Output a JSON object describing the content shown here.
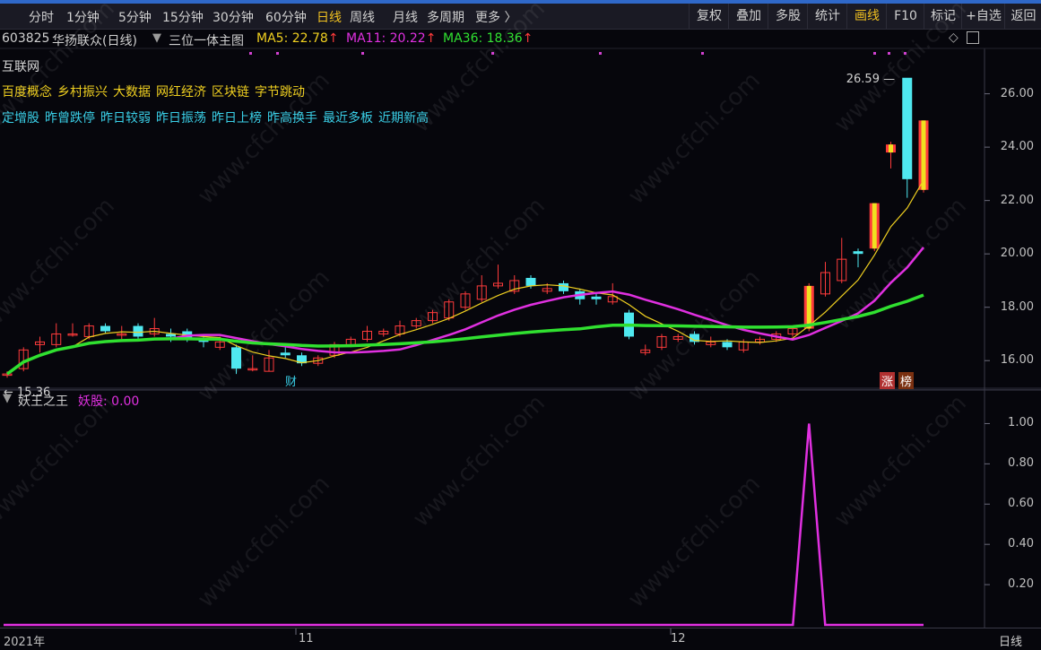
{
  "periods": [
    "分时",
    "1分钟",
    "5分钟",
    "15分钟",
    "30分钟",
    "60分钟",
    "日线",
    "周线",
    "月线",
    "多周期",
    "更多 〉"
  ],
  "active_period": "日线",
  "right_buttons": [
    "复权",
    "叠加",
    "多股",
    "统计",
    "画线",
    "F10",
    "标记",
    "+自选",
    "返回"
  ],
  "active_right": "画线",
  "stock": {
    "code": "603825",
    "name": "华扬联众(日线)",
    "indicator": "三位一体主图"
  },
  "ma": [
    {
      "label": "MA5: 22.78",
      "color": "#f0d020"
    },
    {
      "label": "MA11: 20.22",
      "color": "#e030e0"
    },
    {
      "label": "MA36: 18.36",
      "color": "#30e030"
    }
  ],
  "ma_arrow": "↑",
  "sector": "互联网",
  "concepts": [
    "百度概念",
    "乡村振兴",
    "大数据",
    "网红经济",
    "区块链",
    "字节跳动"
  ],
  "tags": [
    "定增股",
    "昨曾跌停",
    "昨日较弱",
    "昨日振荡",
    "昨日上榜",
    "昨高换手",
    "最近多板",
    "近期新高"
  ],
  "badges": {
    "cai": "财",
    "zhang": "涨",
    "bang": "榜"
  },
  "watermark": "www.cfchi.com",
  "sub": {
    "title": "妖王之王",
    "indicator": "妖股: 0.00"
  },
  "date_labels": [
    {
      "text": "2021年"
    },
    {
      "text": "11"
    },
    {
      "text": "12"
    }
  ],
  "bottom_right": "日线",
  "colors": {
    "up": "#ff3b3b",
    "down": "#4fe8f0",
    "ma5": "#f0d020",
    "ma11": "#e030e0",
    "ma36": "#30e030",
    "yao": "#e030e0",
    "limit_up": "#f0e020"
  },
  "chart_data": {
    "type": "candlestick",
    "price_axis": {
      "ticks": [
        16,
        18,
        20,
        22,
        24,
        26
      ],
      "labels": [
        "16.00",
        "18.00",
        "20.00",
        "22.00",
        "24.00",
        "26.00"
      ],
      "range": [
        15.0,
        27.7
      ]
    },
    "annotations": {
      "high": "26.59",
      "low": "15.36"
    },
    "candles": [
      {
        "o": 15.5,
        "c": 15.5,
        "h": 15.6,
        "l": 15.36
      },
      {
        "o": 15.7,
        "c": 16.4,
        "h": 16.5,
        "l": 15.6
      },
      {
        "o": 16.6,
        "c": 16.7,
        "h": 16.9,
        "l": 16.3
      },
      {
        "o": 16.6,
        "c": 17.0,
        "h": 17.4,
        "l": 16.5
      },
      {
        "o": 17.0,
        "c": 17.0,
        "h": 17.4,
        "l": 16.9
      },
      {
        "o": 16.9,
        "c": 17.3,
        "h": 17.4,
        "l": 16.8
      },
      {
        "o": 17.3,
        "c": 17.1,
        "h": 17.4,
        "l": 17.0
      },
      {
        "o": 17.0,
        "c": 17.0,
        "h": 17.3,
        "l": 16.8
      },
      {
        "o": 17.3,
        "c": 16.9,
        "h": 17.4,
        "l": 16.8
      },
      {
        "o": 17.0,
        "c": 17.2,
        "h": 17.6,
        "l": 16.9
      },
      {
        "o": 17.0,
        "c": 16.9,
        "h": 17.2,
        "l": 16.7
      },
      {
        "o": 17.1,
        "c": 16.8,
        "h": 17.2,
        "l": 16.7
      },
      {
        "o": 16.8,
        "c": 16.7,
        "h": 17.0,
        "l": 16.5
      },
      {
        "o": 16.5,
        "c": 16.7,
        "h": 16.9,
        "l": 16.4
      },
      {
        "o": 16.5,
        "c": 15.7,
        "h": 16.6,
        "l": 15.5
      },
      {
        "o": 15.7,
        "c": 15.7,
        "h": 16.2,
        "l": 15.6
      },
      {
        "o": 15.6,
        "c": 16.1,
        "h": 16.4,
        "l": 15.6
      },
      {
        "o": 16.3,
        "c": 16.2,
        "h": 16.5,
        "l": 16.1
      },
      {
        "o": 16.2,
        "c": 15.9,
        "h": 16.3,
        "l": 15.8
      },
      {
        "o": 15.9,
        "c": 16.1,
        "h": 16.2,
        "l": 15.8
      },
      {
        "o": 16.2,
        "c": 16.6,
        "h": 16.7,
        "l": 16.1
      },
      {
        "o": 16.6,
        "c": 16.8,
        "h": 16.9,
        "l": 16.5
      },
      {
        "o": 16.8,
        "c": 17.1,
        "h": 17.3,
        "l": 16.7
      },
      {
        "o": 17.0,
        "c": 17.1,
        "h": 17.2,
        "l": 16.9
      },
      {
        "o": 17.0,
        "c": 17.3,
        "h": 17.5,
        "l": 16.9
      },
      {
        "o": 17.3,
        "c": 17.5,
        "h": 17.6,
        "l": 17.2
      },
      {
        "o": 17.5,
        "c": 17.8,
        "h": 17.9,
        "l": 17.4
      },
      {
        "o": 17.6,
        "c": 18.2,
        "h": 18.3,
        "l": 17.5
      },
      {
        "o": 18.0,
        "c": 18.5,
        "h": 18.6,
        "l": 17.9
      },
      {
        "o": 18.3,
        "c": 18.8,
        "h": 19.2,
        "l": 18.2
      },
      {
        "o": 18.8,
        "c": 18.9,
        "h": 19.6,
        "l": 18.7
      },
      {
        "o": 18.6,
        "c": 19.0,
        "h": 19.2,
        "l": 18.5
      },
      {
        "o": 19.1,
        "c": 18.8,
        "h": 19.2,
        "l": 18.7
      },
      {
        "o": 18.6,
        "c": 18.7,
        "h": 18.9,
        "l": 18.5
      },
      {
        "o": 18.9,
        "c": 18.6,
        "h": 19.0,
        "l": 18.5
      },
      {
        "o": 18.6,
        "c": 18.3,
        "h": 18.7,
        "l": 18.1
      },
      {
        "o": 18.4,
        "c": 18.3,
        "h": 18.5,
        "l": 18.1
      },
      {
        "o": 18.2,
        "c": 18.4,
        "h": 18.9,
        "l": 18.1
      },
      {
        "o": 17.8,
        "c": 16.9,
        "h": 17.9,
        "l": 16.8
      },
      {
        "o": 16.3,
        "c": 16.4,
        "h": 16.6,
        "l": 16.2
      },
      {
        "o": 16.5,
        "c": 16.9,
        "h": 17.0,
        "l": 16.4
      },
      {
        "o": 16.8,
        "c": 16.9,
        "h": 17.0,
        "l": 16.7
      },
      {
        "o": 17.0,
        "c": 16.7,
        "h": 17.1,
        "l": 16.6
      },
      {
        "o": 16.6,
        "c": 16.7,
        "h": 16.9,
        "l": 16.5
      },
      {
        "o": 16.7,
        "c": 16.5,
        "h": 16.8,
        "l": 16.4
      },
      {
        "o": 16.4,
        "c": 16.7,
        "h": 16.8,
        "l": 16.3
      },
      {
        "o": 16.7,
        "c": 16.8,
        "h": 16.9,
        "l": 16.6
      },
      {
        "o": 16.8,
        "c": 17.0,
        "h": 17.1,
        "l": 16.7
      },
      {
        "o": 17.0,
        "c": 17.2,
        "h": 17.3,
        "l": 16.9
      },
      {
        "o": 17.2,
        "c": 18.8,
        "h": 18.9,
        "l": 17.1,
        "limit": true
      },
      {
        "o": 18.5,
        "c": 19.3,
        "h": 19.7,
        "l": 18.4
      },
      {
        "o": 19.0,
        "c": 19.8,
        "h": 20.6,
        "l": 18.9
      },
      {
        "o": 20.1,
        "c": 20.0,
        "h": 20.2,
        "l": 19.5
      },
      {
        "o": 20.2,
        "c": 21.9,
        "h": 21.9,
        "l": 20.1,
        "limit": true
      },
      {
        "o": 23.8,
        "c": 24.1,
        "h": 24.2,
        "l": 23.2,
        "limit": true
      },
      {
        "o": 26.6,
        "c": 22.8,
        "h": 26.59,
        "l": 22.1
      },
      {
        "o": 22.4,
        "c": 25.0,
        "h": 25.0,
        "l": 22.3,
        "limit": true
      }
    ],
    "sub": {
      "name": "妖股",
      "range": [
        0,
        1.1
      ],
      "ticks": [
        0.2,
        0.4,
        0.6,
        0.8,
        1.0
      ],
      "labels": [
        "0.20",
        "0.40",
        "0.60",
        "0.80",
        "1.00"
      ],
      "spike_index": 49,
      "spike_value": 1.0,
      "current": 0.0
    }
  }
}
